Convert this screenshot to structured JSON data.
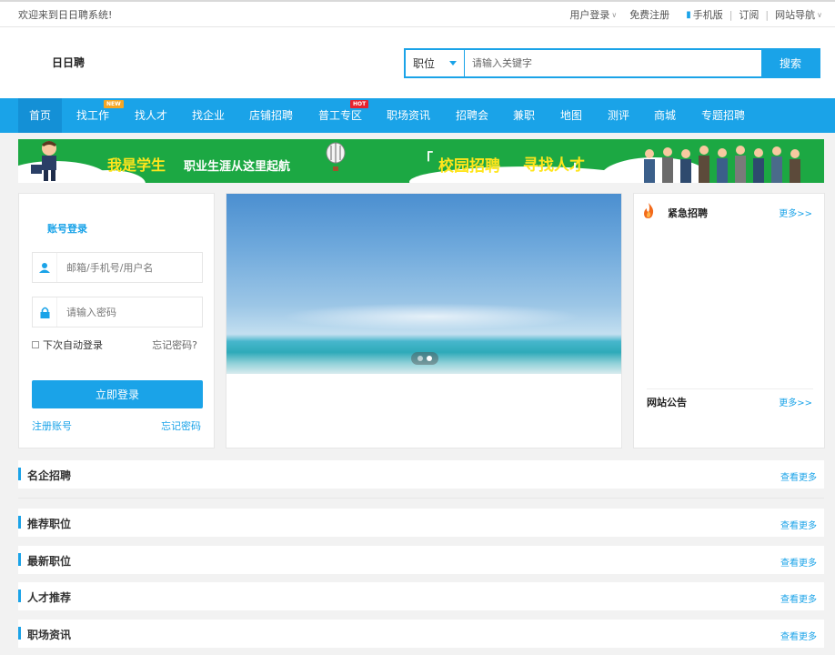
{
  "topbar": {
    "welcome": "欢迎来到日日聘系统!",
    "user_login": "用户登录",
    "register": "免费注册",
    "mobile": "手机版",
    "subscribe": "订阅",
    "site_nav": "网站导航"
  },
  "header": {
    "logo": "日日聘",
    "search_type": "职位",
    "search_placeholder": "请输入关键字",
    "search_button": "搜索"
  },
  "nav": {
    "items": [
      {
        "label": "首页",
        "active": true
      },
      {
        "label": "找工作",
        "badge": "NEW"
      },
      {
        "label": "找人才"
      },
      {
        "label": "找企业"
      },
      {
        "label": "店铺招聘"
      },
      {
        "label": "普工专区",
        "badge": "HOT"
      },
      {
        "label": "职场资讯"
      },
      {
        "label": "招聘会"
      },
      {
        "label": "兼职"
      },
      {
        "label": "地图"
      },
      {
        "label": "测评"
      },
      {
        "label": "商城"
      },
      {
        "label": "专题招聘"
      }
    ]
  },
  "banner": {
    "text1": "我是学生",
    "text2": "职业生涯从这里起航",
    "text3": "校园招聘",
    "text4": "寻找人才"
  },
  "login": {
    "title": "账号登录",
    "username_placeholder": "邮箱/手机号/用户名",
    "password_placeholder": "请输入密码",
    "remember": "下次自动登录",
    "forgot": "忘记密码?",
    "submit": "立即登录",
    "register_link": "注册账号",
    "forgot_link": "忘记密码"
  },
  "urgent": {
    "title": "紧急招聘",
    "more": "更多>>",
    "notice_title": "网站公告",
    "notice_more": "更多>>"
  },
  "sections": [
    {
      "title": "名企招聘",
      "more": "查看更多"
    },
    {
      "title": "推荐职位",
      "more": "查看更多"
    },
    {
      "title": "最新职位",
      "more": "查看更多"
    },
    {
      "title": "人才推荐",
      "more": "查看更多"
    },
    {
      "title": "职场资讯",
      "more": "查看更多"
    }
  ],
  "colors": {
    "accent": "#1aa3e8",
    "nav_active": "#1490d6",
    "banner_green": "#1ca843",
    "banner_yellow": "#ffe51c"
  }
}
